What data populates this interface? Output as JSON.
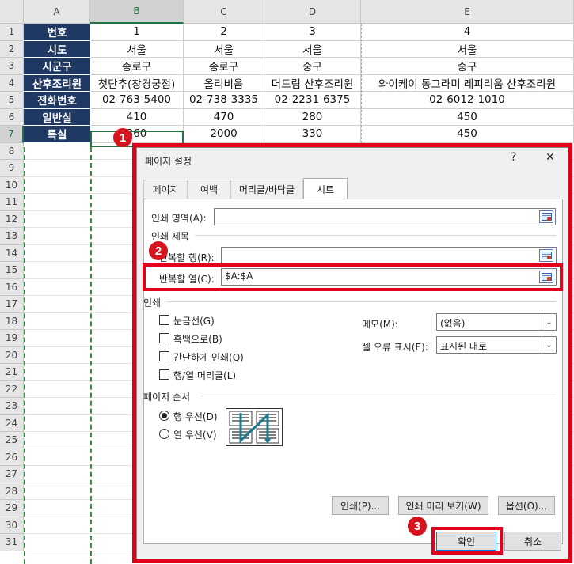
{
  "columns": [
    "A",
    "B",
    "C",
    "D",
    "E"
  ],
  "rows": [
    "1",
    "2",
    "3",
    "4",
    "5",
    "6",
    "7",
    "8",
    "9",
    "10",
    "11",
    "12",
    "13",
    "14",
    "15",
    "16",
    "17",
    "18",
    "19",
    "20",
    "21",
    "22",
    "23",
    "24",
    "25",
    "26",
    "27",
    "28",
    "29",
    "30",
    "31"
  ],
  "table": {
    "labels": [
      "번호",
      "시도",
      "시군구",
      "산후조리원",
      "전화번호",
      "일반실",
      "특실"
    ],
    "b": [
      "1",
      "서울",
      "종로구",
      "첫단추(창경궁점)",
      "02-763-5400",
      "410",
      "360"
    ],
    "c": [
      "2",
      "서울",
      "종로구",
      "올리비움",
      "02-738-3335",
      "470",
      "2000"
    ],
    "d": [
      "3",
      "서울",
      "중구",
      "더드림 산후조리원",
      "02-2231-6375",
      "280",
      "330"
    ],
    "e": [
      "4",
      "서울",
      "중구",
      "와이케이 동그라미 레피리움 산후조리원",
      "02-6012-1010",
      "450",
      "450"
    ]
  },
  "badges": [
    "1",
    "2",
    "3"
  ],
  "dialog": {
    "title": "페이지 설정",
    "help": "?",
    "close": "✕",
    "tabs": [
      "페이지",
      "여백",
      "머리글/바닥글",
      "시트"
    ],
    "print_area_label": "인쇄 영역(A):",
    "print_area_value": "",
    "print_titles_group": "인쇄 제목",
    "repeat_rows_label": "반복할 행(R):",
    "repeat_rows_value": "",
    "repeat_cols_label": "반복할 열(C):",
    "repeat_cols_value": "$A:$A",
    "print_group": "인쇄",
    "checkboxes": [
      "눈금선(G)",
      "흑백으로(B)",
      "간단하게 인쇄(Q)",
      "행/열 머리글(L)"
    ],
    "memo_label": "메모(M):",
    "memo_value": "(없음)",
    "cell_error_label": "셀 오류 표시(E):",
    "cell_error_value": "표시된 대로",
    "page_order_group": "페이지 순서",
    "order_options": [
      "행 우선(D)",
      "열 우선(V)"
    ],
    "print_btn": "인쇄(P)...",
    "preview_btn": "인쇄 미리 보기(W)",
    "options_btn": "옵션(O)...",
    "ok_btn": "확인",
    "cancel_btn": "취소"
  },
  "colors": {
    "label_bg": "#1f3864",
    "highlight": "#e3001b",
    "page_break": "#3a8a4a"
  }
}
